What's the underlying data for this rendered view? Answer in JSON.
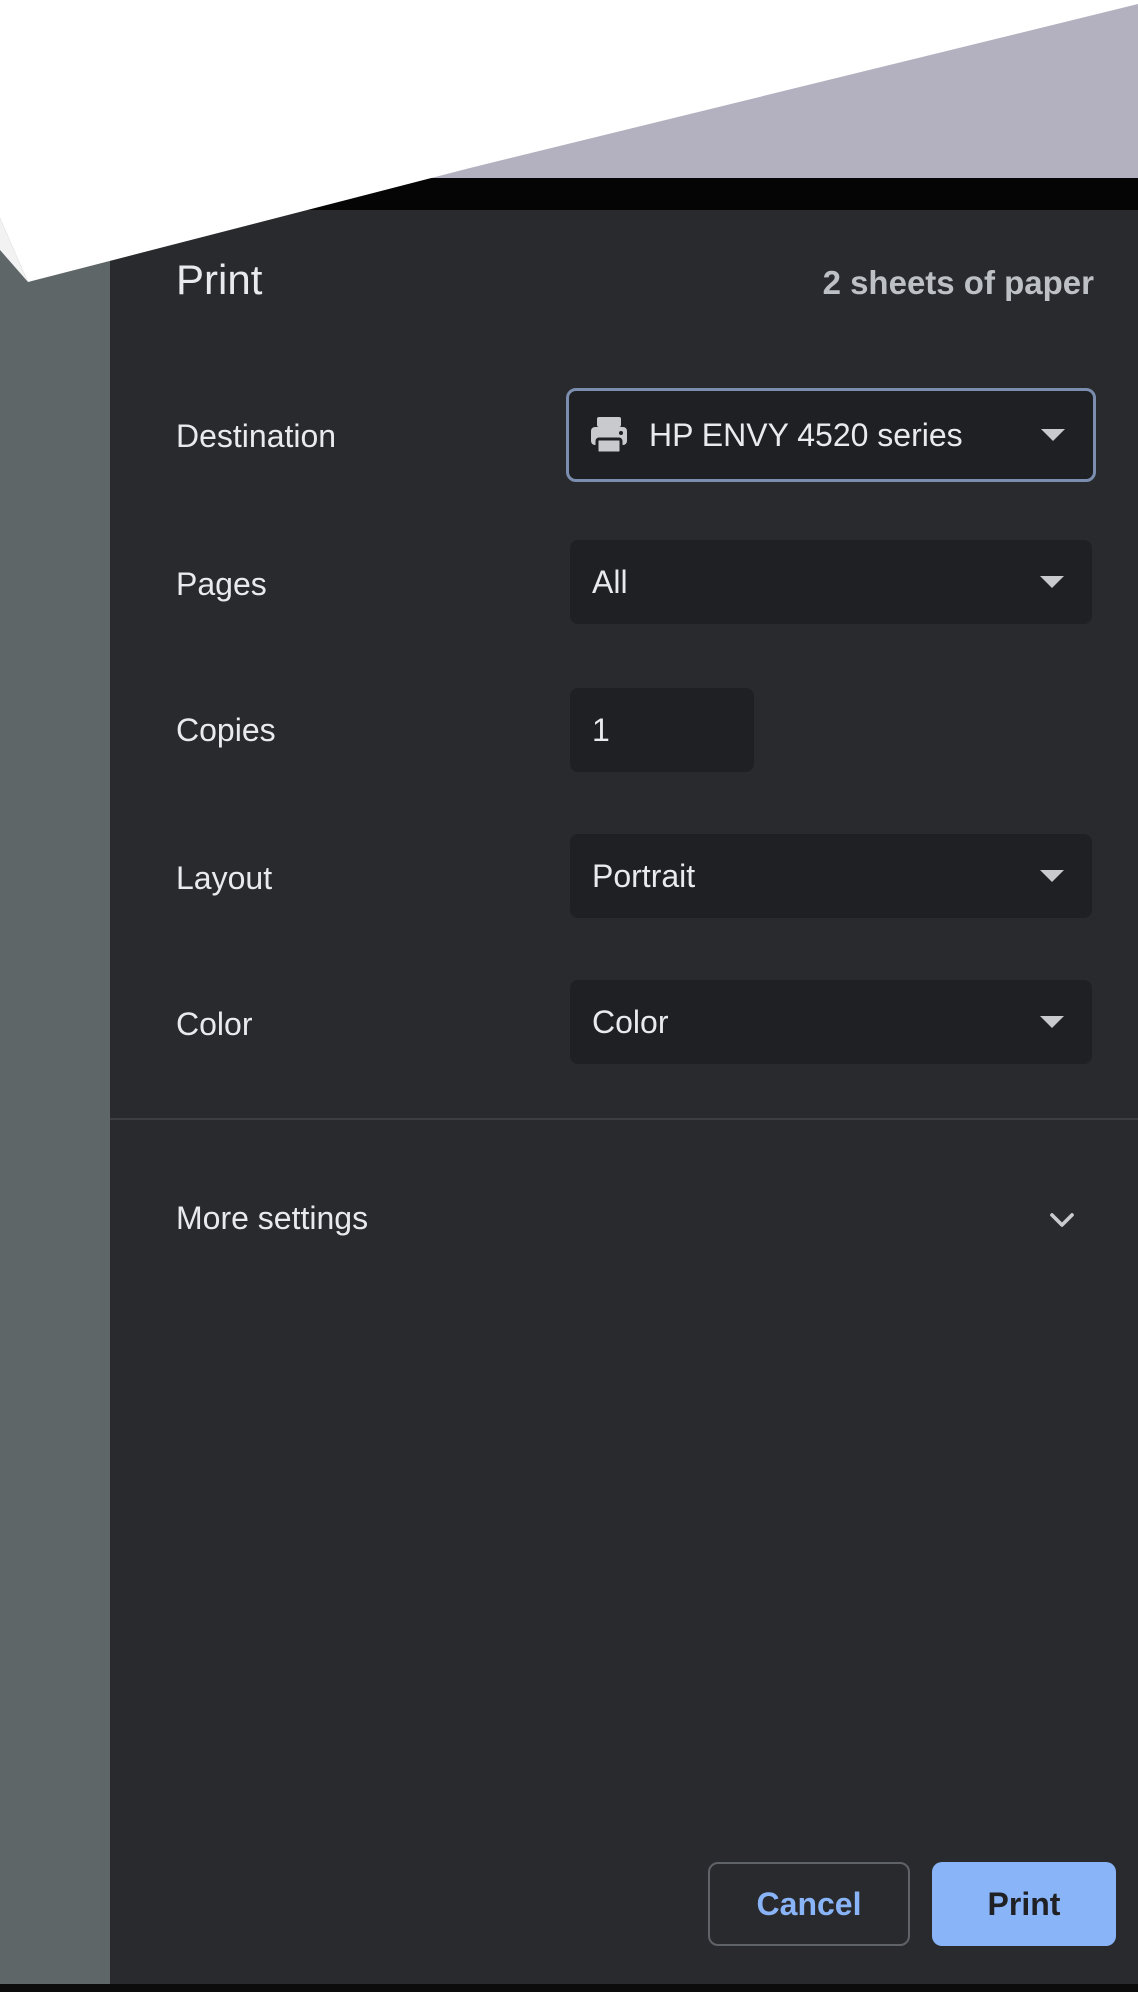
{
  "header": {
    "title": "Print",
    "sheet_count": "2 sheets of paper"
  },
  "settings": {
    "destination": {
      "label": "Destination",
      "value": "HP ENVY 4520 series",
      "icon": "printer-icon"
    },
    "pages": {
      "label": "Pages",
      "value": "All"
    },
    "copies": {
      "label": "Copies",
      "value": "1"
    },
    "layout": {
      "label": "Layout",
      "value": "Portrait"
    },
    "color": {
      "label": "Color",
      "value": "Color"
    }
  },
  "more_settings": {
    "label": "More settings",
    "icon": "chevron-down-icon"
  },
  "actions": {
    "cancel_label": "Cancel",
    "print_label": "Print"
  },
  "colors": {
    "panel_bg": "#292a2d",
    "field_bg": "#1f2023",
    "accent": "#8ab4f8",
    "preview_strip": "#5f6668",
    "focus_border": "#7c8eaf"
  }
}
